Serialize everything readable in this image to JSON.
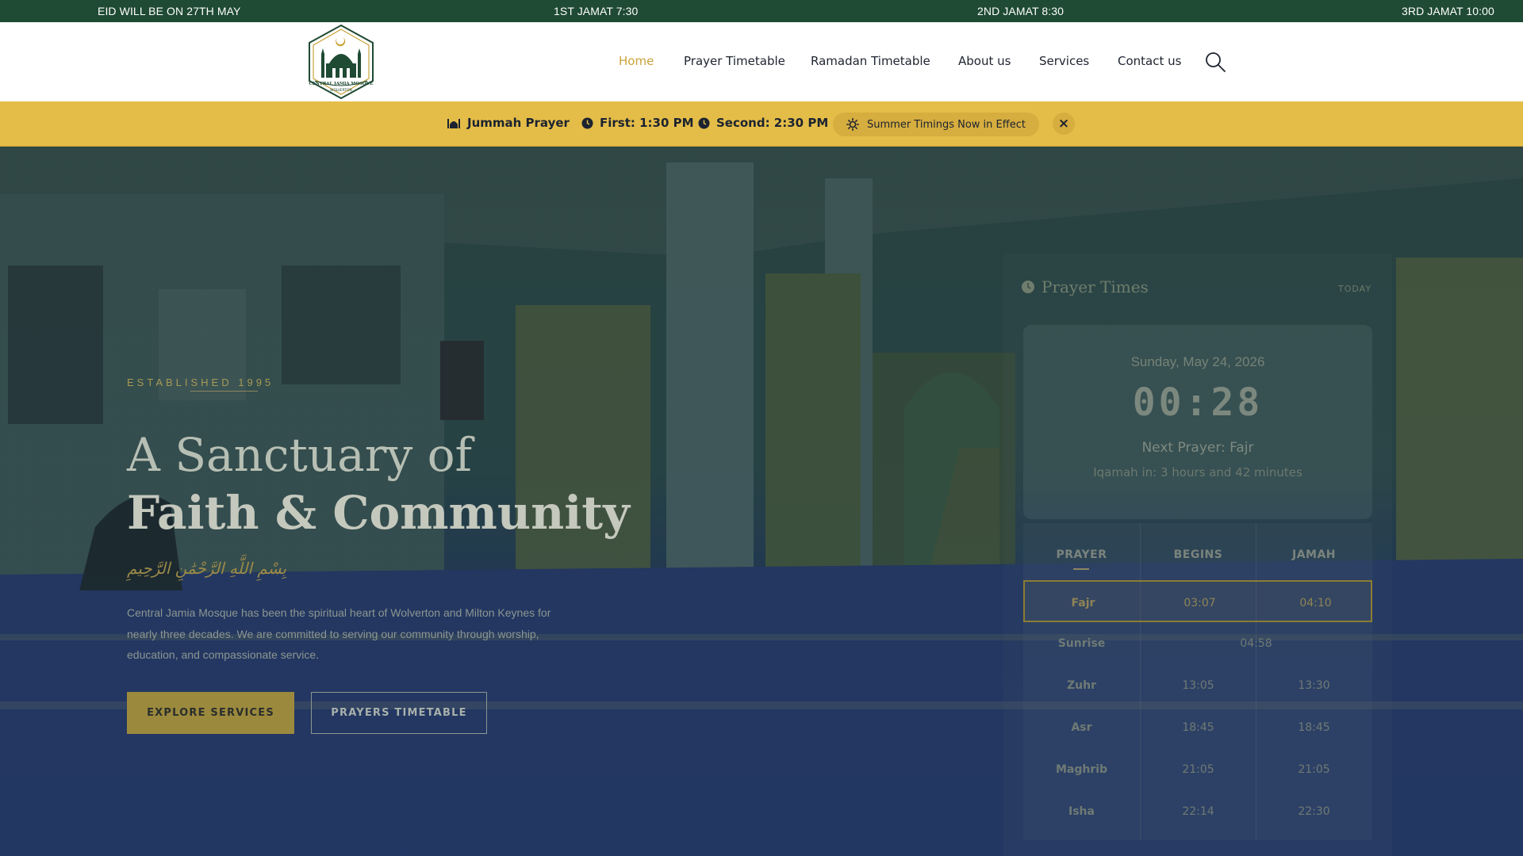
{
  "ticker": {
    "eid": "EID WILL BE ON 27TH MAY",
    "jamat1": "1ST JAMAT 7:30",
    "jamat2": "2ND JAMAT 8:30",
    "jamat3": "3RD JAMAT 10:00"
  },
  "header": {
    "logo_text": "CENTRAL JAMIA MOSQUE",
    "logo_subtext": "WOLVERTON",
    "nav": [
      {
        "label": "Home",
        "active": true
      },
      {
        "label": "Prayer Timetable"
      },
      {
        "label": "Ramadan Timetable"
      },
      {
        "label": "About us"
      },
      {
        "label": "Services"
      },
      {
        "label": "Contact us"
      }
    ],
    "search_icon": "search-icon"
  },
  "announcement": {
    "jummah_label": "Jummah Prayer",
    "first": "First: 1:30 PM",
    "second": "Second: 2:30 PM",
    "summer": "Summer Timings Now in Effect",
    "close": "×"
  },
  "hero": {
    "established": "ESTABLISHED 1995",
    "title_line1": "A Sanctuary of",
    "title_line2": "Faith & Community",
    "arabic": "بِسْمِ اللَّهِ الرَّحْمَٰنِ الرَّحِيمِ",
    "description": "Central Jamia Mosque has been the spiritual heart of Wolverton and Milton Keynes for nearly three decades. We are committed to serving our community through worship, education, and compassionate service.",
    "btn_explore": "EXPLORE SERVICES",
    "btn_timetable": "PRAYERS TIMETABLE"
  },
  "widget": {
    "title": "Prayer Times",
    "today": "TODAY",
    "date": "Sunday, May 24, 2026",
    "time": "00:28",
    "next_prayer": "Next Prayer: Fajr",
    "iqamah": "Iqamah in: 3 hours and 42 minutes",
    "columns": [
      "PRAYER",
      "BEGINS",
      "JAMAH"
    ],
    "rows": [
      {
        "prayer": "Fajr",
        "begins": "03:07",
        "jamah": "04:10",
        "highlight": true
      },
      {
        "prayer": "Sunrise",
        "begins": "04:58",
        "jamah": "",
        "merged": true
      },
      {
        "prayer": "Zuhr",
        "begins": "13:05",
        "jamah": "13:30"
      },
      {
        "prayer": "Asr",
        "begins": "18:45",
        "jamah": "18:45"
      },
      {
        "prayer": "Maghrib",
        "begins": "21:05",
        "jamah": "21:05"
      },
      {
        "prayer": "Isha",
        "begins": "22:14",
        "jamah": "22:30"
      }
    ]
  },
  "colors": {
    "ticker_bg": "#1f4a33",
    "accent_gold": "#e4bd48",
    "nav_active": "#c9a33a"
  }
}
